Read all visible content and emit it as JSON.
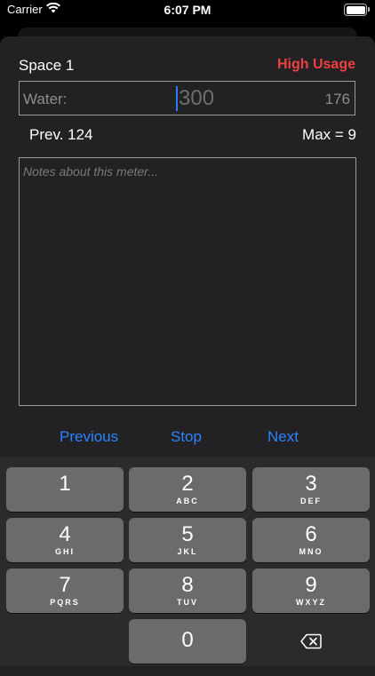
{
  "status_bar": {
    "carrier": "Carrier",
    "time": "6:07 PM"
  },
  "meter": {
    "space_name": "Space 1",
    "usage_badge": "High Usage",
    "usage_color": "#ef4040",
    "reading_label": "Water:",
    "reading_placeholder": "300",
    "reading_value": "",
    "expected_reading": "176",
    "previous": "Prev. 124",
    "max": "Max = 9",
    "notes_placeholder": "Notes about this meter..."
  },
  "navigation": {
    "previous": "Previous",
    "stop": "Stop",
    "next": "Next"
  },
  "accent_color": "#2a84ff",
  "keypad": {
    "keys": [
      {
        "digit": "1",
        "letters": ""
      },
      {
        "digit": "2",
        "letters": "ABC"
      },
      {
        "digit": "3",
        "letters": "DEF"
      },
      {
        "digit": "4",
        "letters": "GHI"
      },
      {
        "digit": "5",
        "letters": "JKL"
      },
      {
        "digit": "6",
        "letters": "MNO"
      },
      {
        "digit": "7",
        "letters": "PQRS"
      },
      {
        "digit": "8",
        "letters": "TUV"
      },
      {
        "digit": "9",
        "letters": "WXYZ"
      },
      {
        "digit": "0",
        "letters": ""
      }
    ],
    "delete_icon": "backspace-icon"
  }
}
